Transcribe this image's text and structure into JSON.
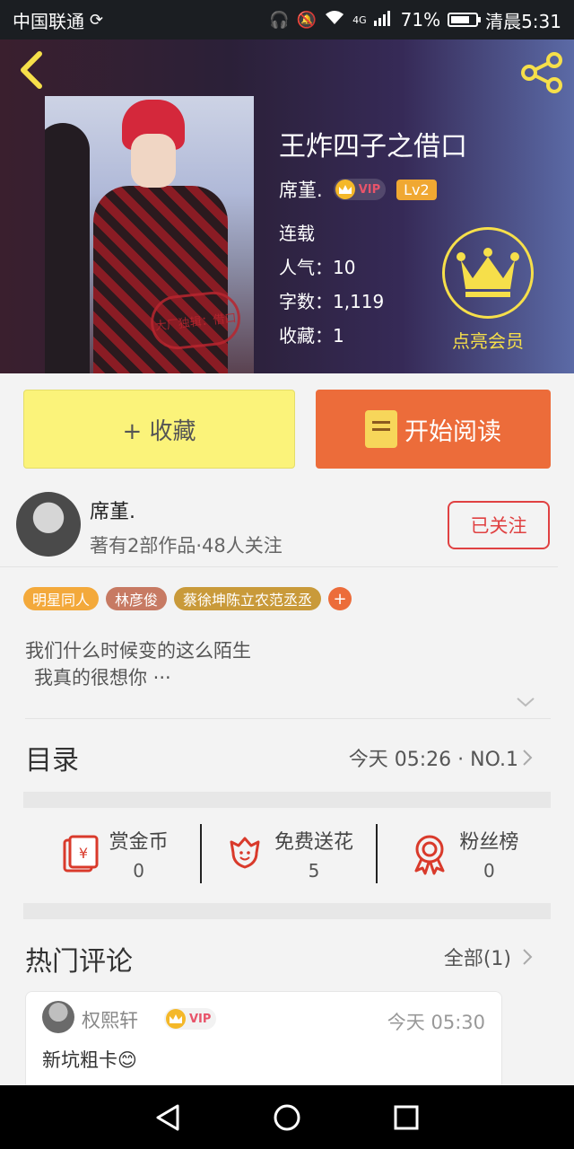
{
  "status_bar": {
    "carrier": "中国联通",
    "battery": "71%",
    "time": "清晨5:31",
    "signal": "4G"
  },
  "header": {
    "title": "王炸四子之借口",
    "author": "席堇.",
    "vip_label": "VIP",
    "level": "Lv2",
    "status": "连载",
    "popularity": "人气：10",
    "word_count": "字数：1,119",
    "favorites": "收藏：1",
    "member_label": "点亮会员",
    "cover_stamp": "大厂独辑：借口"
  },
  "actions": {
    "collect_label": "+ 收藏",
    "read_label": "开始阅读"
  },
  "author_card": {
    "name": "席堇.",
    "info": "著有2部作品·48人关注",
    "follow_label": "已关注"
  },
  "tags": [
    {
      "label": "明星同人",
      "color": "#f3a93b"
    },
    {
      "label": "林彦俊",
      "color": "#c77a63"
    },
    {
      "label": "蔡徐坤陈立农范丞丞",
      "color": "#c99a3a"
    }
  ],
  "summary": {
    "line1": "我们什么时候变的这么陌生",
    "line2": "我真的很想你 ···"
  },
  "catalog": {
    "label": "目录",
    "update": "今天 05:26 · NO.1"
  },
  "stats": [
    {
      "label": "赏金币",
      "value": "0",
      "icon": "red-envelope-icon"
    },
    {
      "label": "免费送花",
      "value": "5",
      "icon": "flower-icon"
    },
    {
      "label": "粉丝榜",
      "value": "0",
      "icon": "medal-icon"
    }
  ],
  "comments": {
    "label": "热门评论",
    "all_label": "全部(1)",
    "items": [
      {
        "user": "权熙轩",
        "vip": "VIP",
        "time": "今天 05:30",
        "text": "新坑粗卡😊"
      }
    ]
  },
  "colors": {
    "accent_orange": "#ec6c3a",
    "collect_yellow": "#fbf37a",
    "follow_red": "#e04142",
    "member_gold": "#f6df4a"
  }
}
